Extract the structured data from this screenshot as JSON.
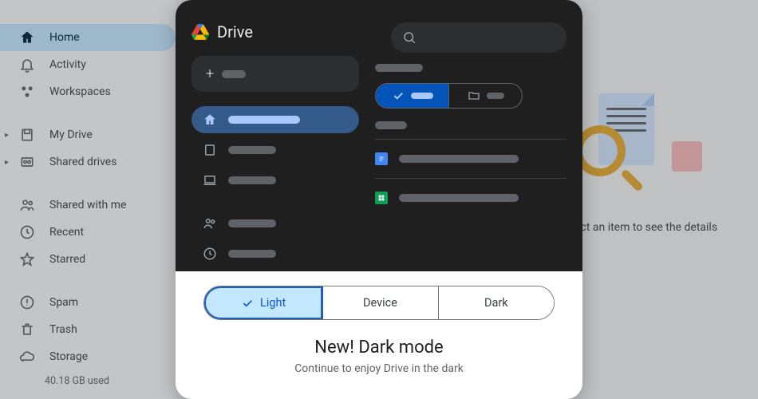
{
  "sidebar": {
    "items": [
      {
        "label": "Home",
        "icon": "home",
        "active": true
      },
      {
        "label": "Activity",
        "icon": "bell"
      },
      {
        "label": "Workspaces",
        "icon": "workspaces"
      }
    ],
    "drives": [
      {
        "label": "My Drive",
        "icon": "drive",
        "expand": true
      },
      {
        "label": "Shared drives",
        "icon": "shared-drives",
        "expand": true
      }
    ],
    "sections": [
      {
        "label": "Shared with me",
        "icon": "shared"
      },
      {
        "label": "Recent",
        "icon": "clock"
      },
      {
        "label": "Starred",
        "icon": "star"
      }
    ],
    "footer": [
      {
        "label": "Spam",
        "icon": "spam"
      },
      {
        "label": "Trash",
        "icon": "trash"
      },
      {
        "label": "Storage",
        "icon": "cloud"
      }
    ],
    "storage_used": "40.18 GB used"
  },
  "details_hint": "Select an item to see the details",
  "modal": {
    "preview_title": "Drive",
    "theme_options": {
      "light": "Light",
      "device": "Device",
      "dark": "Dark"
    },
    "title": "New! Dark mode",
    "subtitle": "Continue to enjoy Drive in the dark"
  }
}
